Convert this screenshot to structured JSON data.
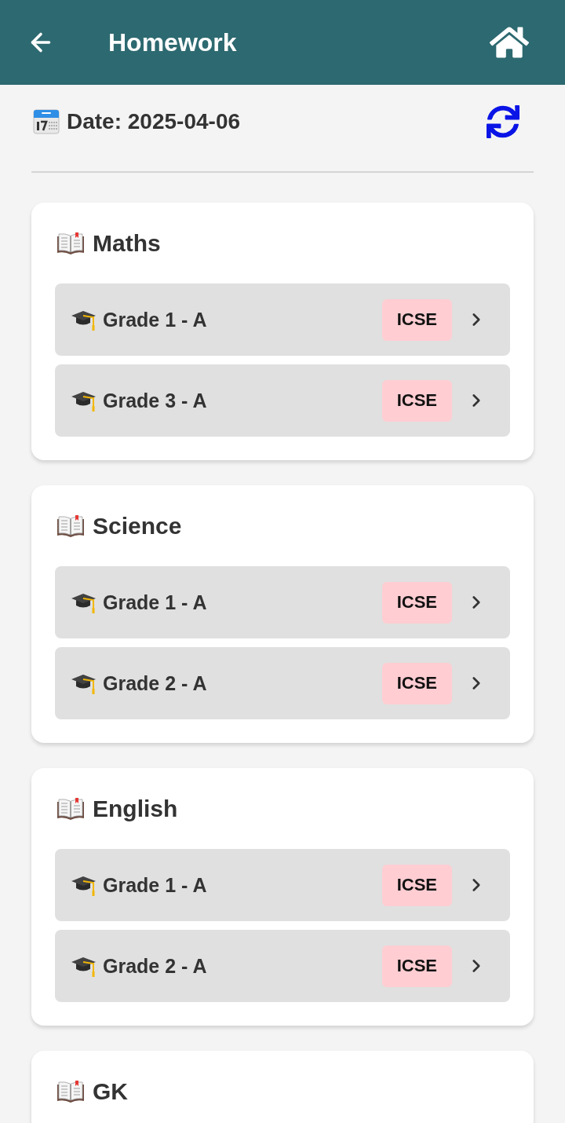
{
  "header": {
    "title": "Homework"
  },
  "date_bar": {
    "label": "Date: 2025-04-06"
  },
  "subjects": [
    {
      "name": "Maths",
      "classes": [
        {
          "name": "Grade 1 - A",
          "board": "ICSE"
        },
        {
          "name": "Grade 3 - A",
          "board": "ICSE"
        }
      ]
    },
    {
      "name": "Science",
      "classes": [
        {
          "name": "Grade 1 - A",
          "board": "ICSE"
        },
        {
          "name": "Grade 2 - A",
          "board": "ICSE"
        }
      ]
    },
    {
      "name": "English",
      "classes": [
        {
          "name": "Grade 1 - A",
          "board": "ICSE"
        },
        {
          "name": "Grade 2 - A",
          "board": "ICSE"
        }
      ]
    },
    {
      "name": "GK"
    }
  ]
}
